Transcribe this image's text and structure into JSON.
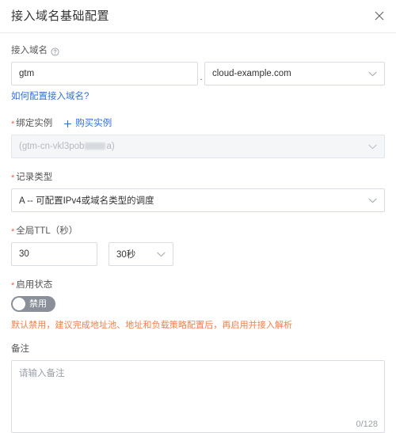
{
  "dialog": {
    "title": "接入域名基础配置",
    "close_icon": "close-icon"
  },
  "fields": {
    "access_domain": {
      "label": "接入域名",
      "help_icon": "help-circle-icon",
      "prefix_value": "gtm",
      "prefix_placeholder": "",
      "separator": ".",
      "suffix_value": "cloud-example.com",
      "helper_link": "如何配置接入域名?"
    },
    "bind_instance": {
      "required_mark": "*",
      "label": "绑定实例",
      "buy_link": "购买实例",
      "plus_icon": "plus-icon",
      "value_prefix": "(gtm-cn-vkl3pob",
      "value_suffix": "a)"
    },
    "record_type": {
      "required_mark": "*",
      "label": "记录类型",
      "value": "A -- 可配置IPv4或域名类型的调度"
    },
    "global_ttl": {
      "required_mark": "*",
      "label": "全局TTL（秒）",
      "value": "30",
      "unit_value": "30秒"
    },
    "enable_status": {
      "required_mark": "*",
      "label": "启用状态",
      "toggle_text": "禁用",
      "toggle_on": false,
      "warning": "默认禁用，建议完成地址池、地址和负载策略配置后，再启用并接入解析"
    },
    "remark": {
      "label": "备注",
      "placeholder": "请输入备注",
      "counter": "0/128"
    }
  },
  "colors": {
    "link": "#2f6fdd",
    "warning": "#f0804a",
    "required": "#e8664d",
    "border": "#d9dde3",
    "toggle_off": "#8a8f99"
  }
}
